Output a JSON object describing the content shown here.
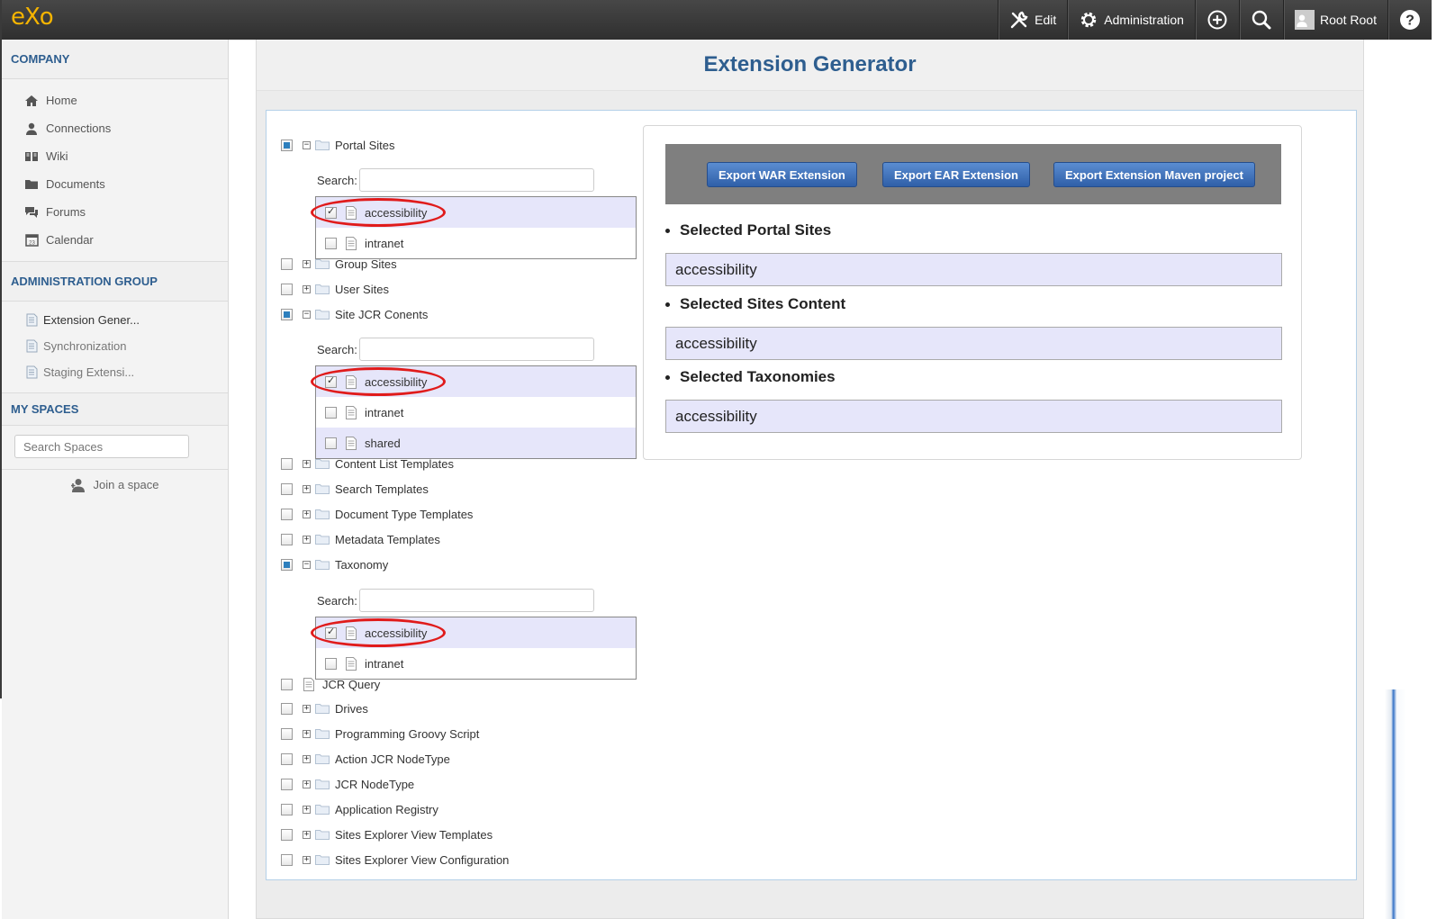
{
  "topbar": {
    "logo": "eXo",
    "items": [
      {
        "label": "Edit",
        "icon": "wrench-icon"
      },
      {
        "label": "Administration",
        "icon": "gear-icon"
      },
      {
        "label": "",
        "icon": "add-circle-icon"
      },
      {
        "label": "",
        "icon": "search-icon"
      },
      {
        "label": "Root Root",
        "icon": "avatar"
      },
      {
        "label": "",
        "icon": "help-icon"
      }
    ]
  },
  "sidebar": {
    "company_title": "COMPANY",
    "company_items": [
      {
        "label": "Home",
        "icon": "home-icon"
      },
      {
        "label": "Connections",
        "icon": "user-icon"
      },
      {
        "label": "Wiki",
        "icon": "book-icon"
      },
      {
        "label": "Documents",
        "icon": "folder-icon"
      },
      {
        "label": "Forums",
        "icon": "chat-icon"
      },
      {
        "label": "Calendar",
        "icon": "calendar-icon"
      }
    ],
    "admin_title": "ADMINISTRATION GROUP",
    "admin_items": [
      {
        "label": "Extension Gener...",
        "icon": "page-icon"
      },
      {
        "label": "Synchronization",
        "icon": "page-icon"
      },
      {
        "label": "Staging Extensi...",
        "icon": "page-icon"
      }
    ],
    "spaces_title": "MY SPACES",
    "search_placeholder": "Search Spaces",
    "join_label": "Join a space"
  },
  "page": {
    "title": "Extension Generator"
  },
  "tree": {
    "search_label": "Search:",
    "portal_sites": {
      "label": "Portal Sites",
      "state": "partial",
      "children": [
        {
          "label": "accessibility",
          "checked": true
        },
        {
          "label": "intranet",
          "checked": false
        }
      ]
    },
    "group_sites": "Group Sites",
    "user_sites": "User Sites",
    "site_jcr": {
      "label": "Site JCR Conents",
      "state": "partial",
      "children": [
        {
          "label": "accessibility",
          "checked": true
        },
        {
          "label": "intranet",
          "checked": false
        },
        {
          "label": "shared",
          "checked": false
        }
      ]
    },
    "content_list": "Content List Templates",
    "search_templates": "Search Templates",
    "doc_type": "Document Type Templates",
    "metadata": "Metadata Templates",
    "taxonomy": {
      "label": "Taxonomy",
      "state": "partial",
      "children": [
        {
          "label": "accessibility",
          "checked": true
        },
        {
          "label": "intranet",
          "checked": false
        }
      ]
    },
    "jcr_query": "JCR Query",
    "drives": "Drives",
    "groovy": "Programming Groovy Script",
    "action_nodetype": "Action JCR NodeType",
    "jcr_nodetype": "JCR NodeType",
    "app_registry": "Application Registry",
    "se_view_templates": "Sites Explorer View Templates",
    "se_view_config": "Sites Explorer View Configuration"
  },
  "actions": {
    "export_war": "Export WAR Extension",
    "export_ear": "Export EAR Extension",
    "export_maven": "Export Extension Maven project"
  },
  "summary": {
    "portal_title": "Selected Portal Sites",
    "portal_value": "accessibility",
    "content_title": "Selected Sites Content",
    "content_value": "accessibility",
    "taxonomy_title": "Selected Taxonomies",
    "taxonomy_value": "accessibility"
  },
  "colors": {
    "accent": "#2e5e8f",
    "button": "#3a6cb8",
    "highlight": "#e6e6fa",
    "annotation_ring": "#e01b1b",
    "logo": "#f5b400"
  }
}
